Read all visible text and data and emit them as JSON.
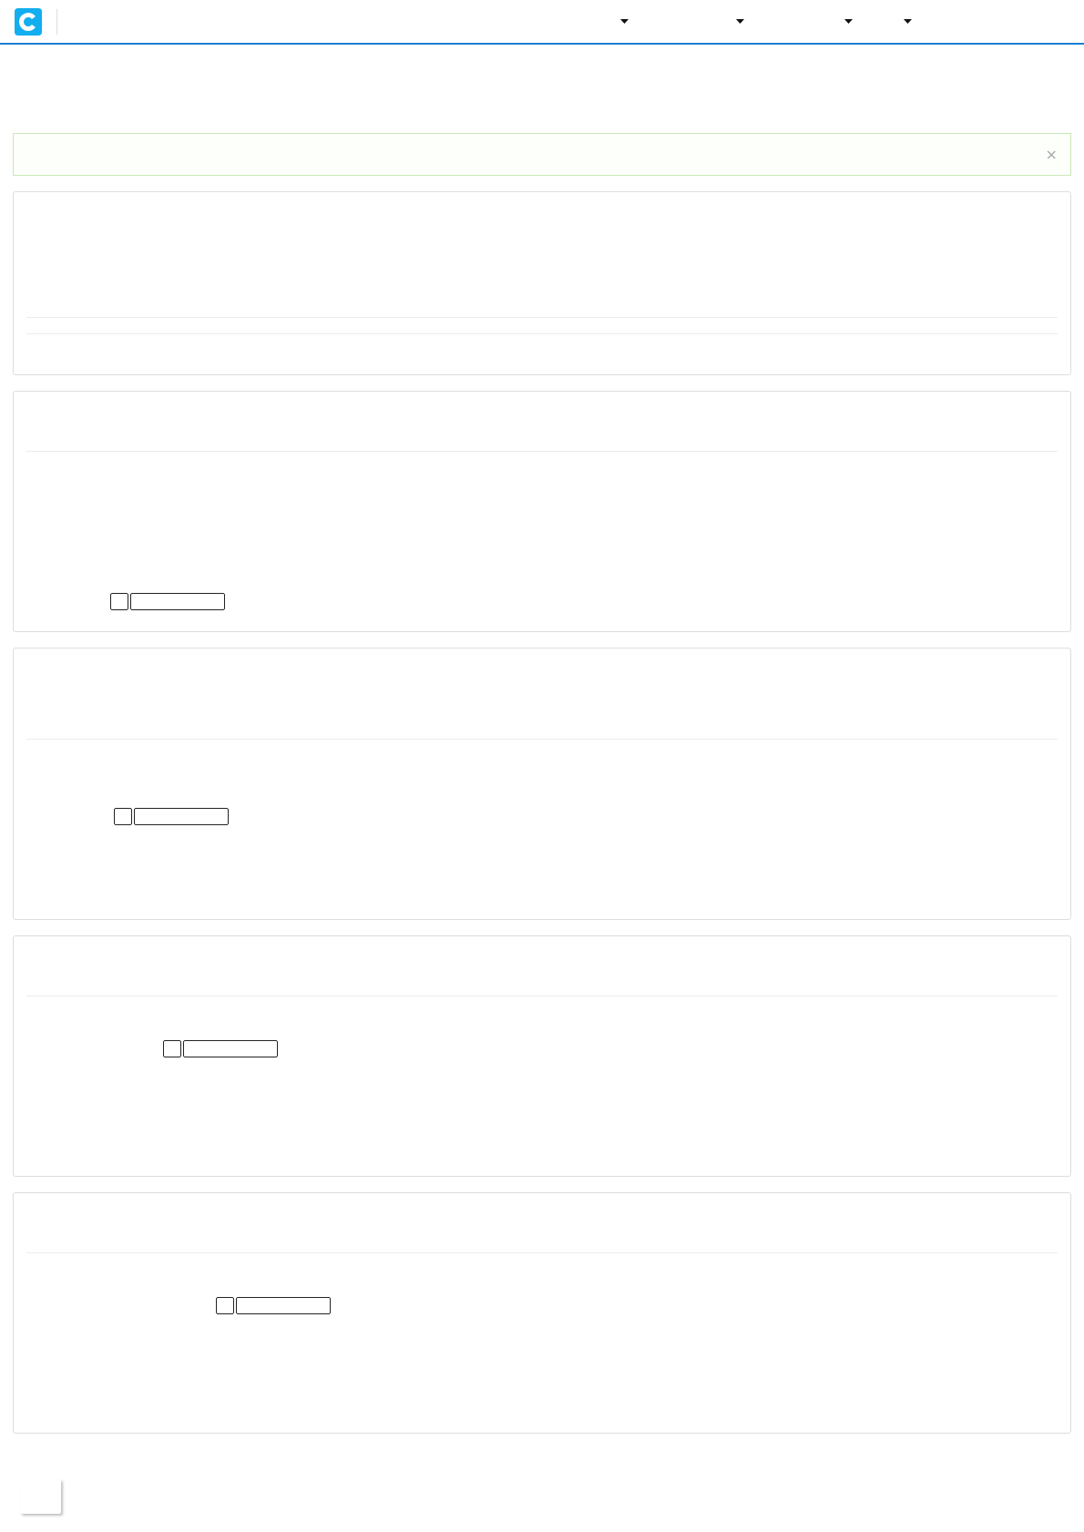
{
  "navbar": {
    "logo": {
      "kind": "logo"
    },
    "menus": [
      {
        "kind": "dropdown"
      },
      {
        "kind": "dropdown"
      },
      {
        "kind": "dropdown"
      },
      {
        "kind": "dropdown"
      }
    ]
  },
  "alert": {
    "close": "×"
  },
  "panels": [
    {
      "rows": [
        {
          "kind": "rule"
        },
        {
          "kind": "rule"
        }
      ]
    },
    {
      "rows": [
        {
          "kind": "rule"
        },
        {
          "kind": "control"
        }
      ]
    },
    {
      "rows": [
        {
          "kind": "rule"
        },
        {
          "kind": "control"
        }
      ]
    },
    {
      "rows": [
        {
          "kind": "rule"
        },
        {
          "kind": "control"
        }
      ]
    },
    {
      "rows": [
        {
          "kind": "rule"
        },
        {
          "kind": "control"
        }
      ]
    }
  ],
  "floating_box": {
    "kind": "card"
  }
}
